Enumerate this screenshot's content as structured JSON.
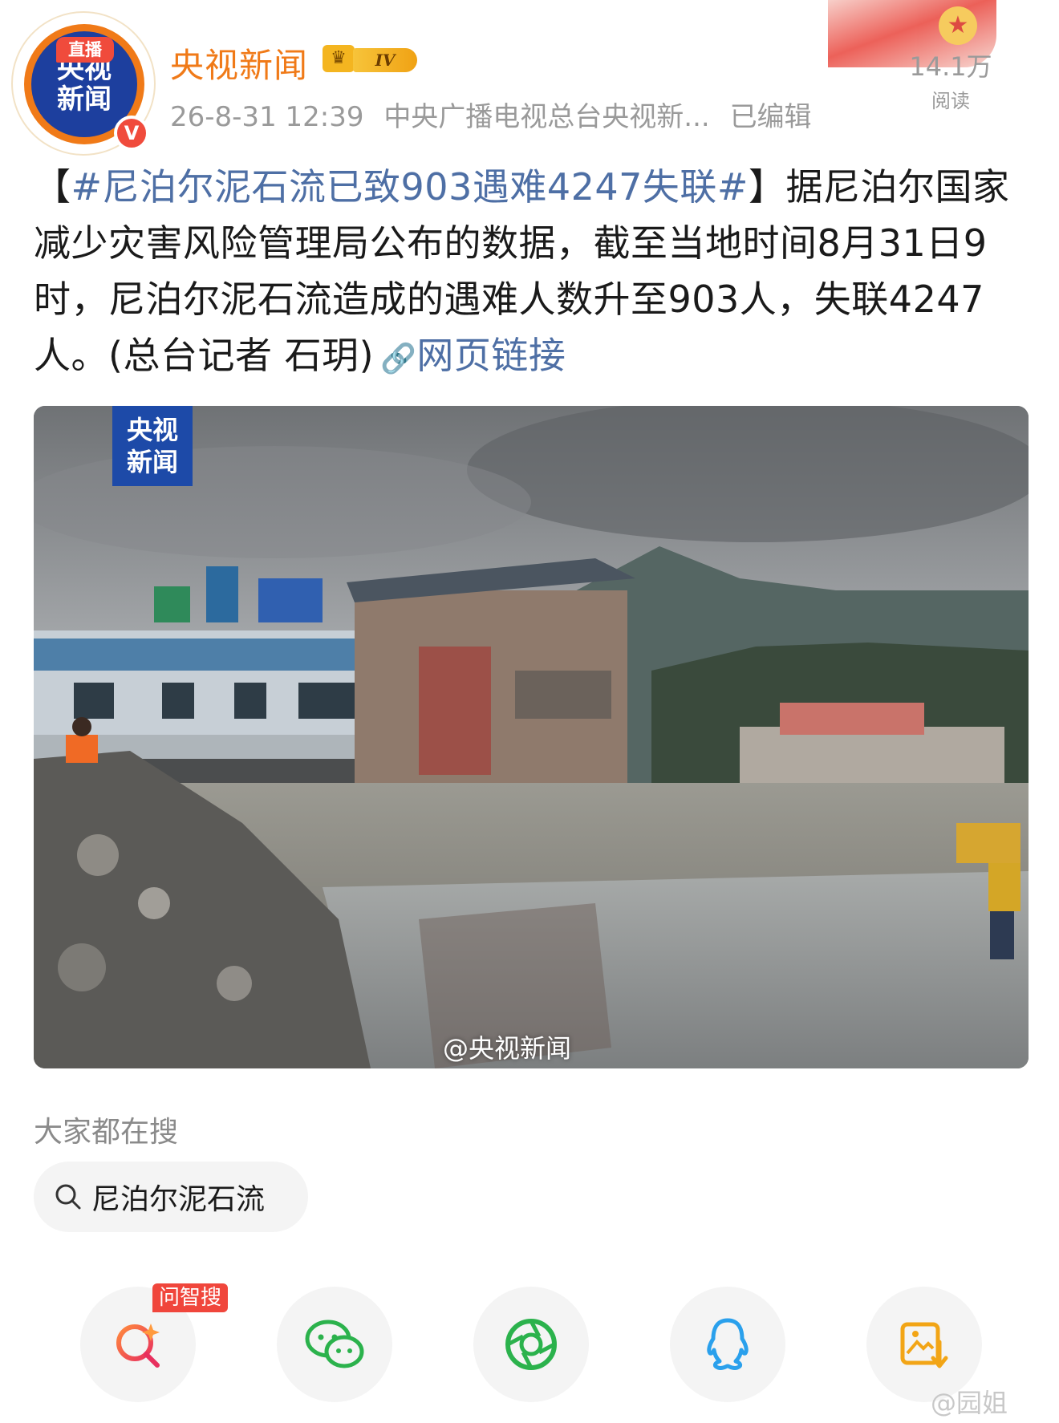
{
  "header": {
    "avatar_live_badge": "直播",
    "avatar_text_line1": "央视",
    "avatar_text_line2": "新闻",
    "verified_mark": "V",
    "user_name": "央视新闻",
    "level_badge": "IV",
    "timestamp": "26-8-31 12:39",
    "source": "中央广播电视总台央视新...",
    "edited": "已编辑",
    "reads_count": "14.1万",
    "reads_label": "阅读"
  },
  "post": {
    "bracket_open": "【",
    "hashtag": "#尼泊尔泥石流已致903遇难4247失联#",
    "bracket_close": "】",
    "body": "据尼泊尔国家减少灾害风险管理局公布的数据，截至当地时间8月31日9时，尼泊尔泥石流造成的遇难人数升至903人，失联4247人。(总台记者 石玥)",
    "link_label": "网页链接"
  },
  "image": {
    "logo_line1": "央视",
    "logo_line2": "新闻",
    "watermark": "@央视新闻"
  },
  "trending": {
    "title": "大家都在搜",
    "chip_label": "尼泊尔泥石流"
  },
  "share": {
    "ask_badge": "问智搜",
    "icons": [
      "ai-search-icon",
      "wechat-icon",
      "moments-icon",
      "qq-icon",
      "save-image-icon"
    ]
  },
  "corner_watermark": "@园姐",
  "colors": {
    "accent_orange": "#f07a18",
    "link_blue": "#4e6fa5",
    "brand_blue": "#1d3f9e",
    "badge_red": "#f04b3c"
  }
}
